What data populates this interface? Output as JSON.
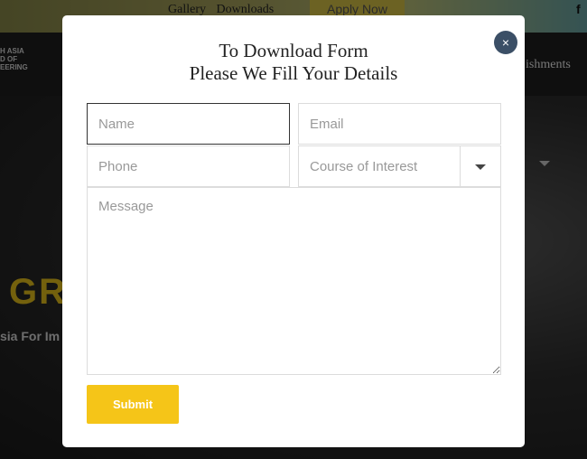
{
  "topbar": {
    "links": [
      "Gallery",
      "Downloads"
    ],
    "apply_label": "Apply Now",
    "social_icon": "facebook-icon"
  },
  "navbar": {
    "logo_lines": [
      "H ASIA",
      "D OF",
      "EERING"
    ],
    "nav_item": "ishments"
  },
  "hero": {
    "headline": "GR",
    "subline": "sia For Im"
  },
  "modal": {
    "close_label": "×",
    "title_line1": "To Download Form",
    "title_line2": "Please We Fill Your Details",
    "fields": {
      "name_placeholder": "Name",
      "email_placeholder": "Email",
      "phone_placeholder": "Phone",
      "course_label": "Course of Interest",
      "message_placeholder": "Message"
    },
    "submit_label": "Submit"
  },
  "colors": {
    "accent": "#f5c518",
    "close_bg": "#3b4f66"
  }
}
